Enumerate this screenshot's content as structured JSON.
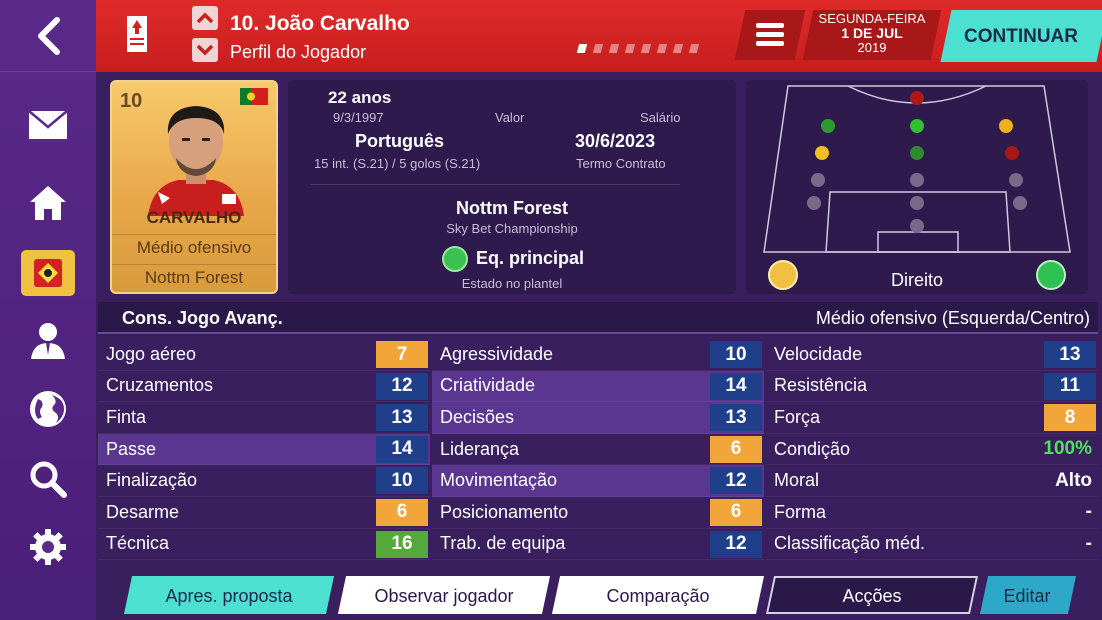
{
  "header": {
    "player_title": "10. João Carvalho",
    "subtitle": "Perfil do Jogador",
    "date_weekday": "SEGUNDA-FEIRA",
    "date_day": "1 DE JUL",
    "date_year": "2019",
    "continue_label": "CONTINUAR"
  },
  "card": {
    "number": "10",
    "surname": "CARVALHO",
    "position": "Médio ofensivo",
    "club": "Nottm Forest"
  },
  "info": {
    "age": "22 anos",
    "dob": "9/3/1997",
    "value_label": "Valor",
    "salary_label": "Salário",
    "nationality": "Português",
    "contract_end": "30/6/2023",
    "international": "15 int. (S.21) / 5 golos (S.21)",
    "contract_label": "Termo Contrato",
    "club_name": "Nottm Forest",
    "league": "Sky Bet Championship",
    "squad_status": "Eq. principal",
    "squad_status_label": "Estado no plantel"
  },
  "pitch": {
    "foot_label": "Direito"
  },
  "attributes": {
    "role_title": "Cons. Jogo Avanç.",
    "position_title": "Médio ofensivo (Esquerda/Centro)",
    "technical": [
      {
        "label": "Jogo aéreo",
        "value": "7",
        "color": "orange",
        "hl": false
      },
      {
        "label": "Cruzamentos",
        "value": "12",
        "color": "blue",
        "hl": false
      },
      {
        "label": "Finta",
        "value": "13",
        "color": "blue",
        "hl": false
      },
      {
        "label": "Passe",
        "value": "14",
        "color": "blue",
        "hl": true
      },
      {
        "label": "Finalização",
        "value": "10",
        "color": "blue",
        "hl": false
      },
      {
        "label": "Desarme",
        "value": "6",
        "color": "orange",
        "hl": false
      },
      {
        "label": "Técnica",
        "value": "16",
        "color": "green",
        "hl": false
      }
    ],
    "mental": [
      {
        "label": "Agressividade",
        "value": "10",
        "color": "blue",
        "hl": false
      },
      {
        "label": "Criatividade",
        "value": "14",
        "color": "blue",
        "hl": true
      },
      {
        "label": "Decisões",
        "value": "13",
        "color": "blue",
        "hl": true
      },
      {
        "label": "Liderança",
        "value": "6",
        "color": "orange",
        "hl": false
      },
      {
        "label": "Movimentação",
        "value": "12",
        "color": "blue",
        "hl": true
      },
      {
        "label": "Posicionamento",
        "value": "6",
        "color": "orange",
        "hl": false
      },
      {
        "label": "Trab. de equipa",
        "value": "12",
        "color": "blue",
        "hl": false
      }
    ],
    "physical": [
      {
        "label": "Velocidade",
        "value": "13",
        "color": "blue",
        "hl": false
      },
      {
        "label": "Resistência",
        "value": "11",
        "color": "blue",
        "hl": false
      },
      {
        "label": "Força",
        "value": "8",
        "color": "orange",
        "hl": false
      },
      {
        "label": "Condição",
        "value": "100%",
        "color": "plain greentext",
        "hl": false
      },
      {
        "label": "Moral",
        "value": "Alto",
        "color": "plain",
        "hl": false
      },
      {
        "label": "Forma",
        "value": "-",
        "color": "plain",
        "hl": false
      },
      {
        "label": "Classificação méd.",
        "value": "-",
        "color": "plain",
        "hl": false
      }
    ]
  },
  "buttons": {
    "offer": "Apres. proposta",
    "scout": "Observar jogador",
    "compare": "Comparação",
    "actions": "Acções",
    "edit": "Editar"
  },
  "colors": {
    "header_red": "#d42222",
    "accent_teal": "#4be0d0",
    "sidebar_purple": "#5a2a8a",
    "panel_purple": "#2e1a4c"
  }
}
